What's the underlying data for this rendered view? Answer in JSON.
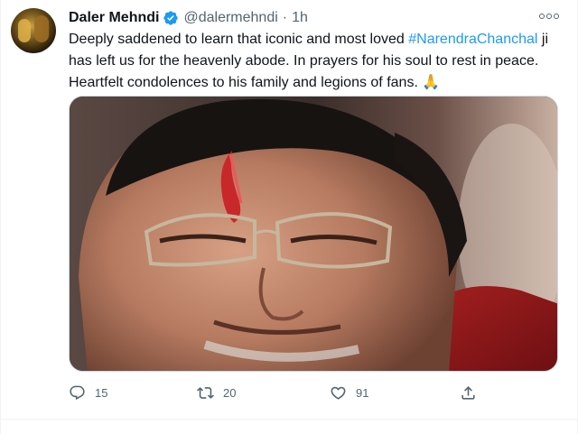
{
  "tweet": {
    "author_name": "Daler Mehndi",
    "handle": "@dalermehndi",
    "separator": "·",
    "time": "1h",
    "text_before": "Deeply saddened to learn that iconic and most loved ",
    "hashtag": "#NarendraChanchal",
    "text_after": " ji has left us for the heavenly abode. In prayers for his soul to rest in peace. Heartfelt condolences to his family and legions of fans.",
    "emoji": "🙏",
    "verified": true
  },
  "actions": {
    "reply_count": "15",
    "retweet_count": "20",
    "like_count": "91"
  },
  "icons": {
    "more": "more-horizontal-icon",
    "reply": "reply-icon",
    "retweet": "retweet-icon",
    "like": "heart-icon",
    "share": "share-icon",
    "verified": "verified-badge-icon"
  },
  "colors": {
    "accent": "#1d9bf0",
    "secondary_text": "#536471",
    "primary_text": "#0f1419"
  }
}
